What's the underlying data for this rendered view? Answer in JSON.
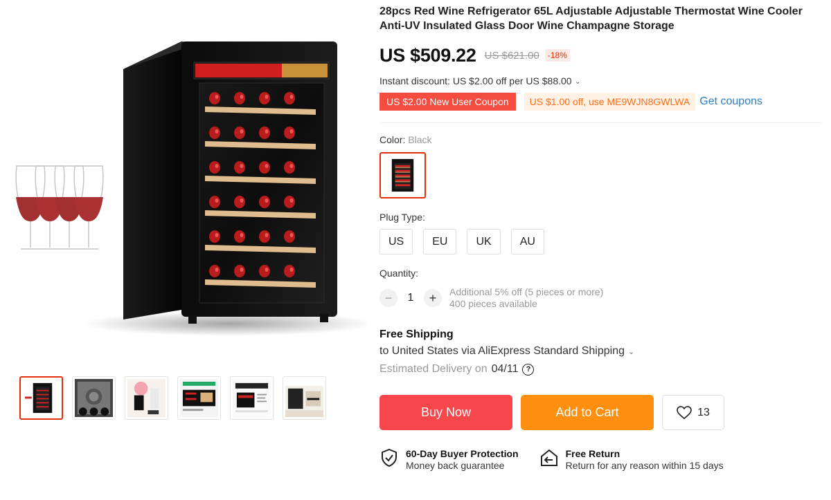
{
  "product": {
    "title": "28pcs Red Wine Refrigerator 65L Adjustable Adjustable Thermostat Wine Cooler Anti-UV Insulated Glass Door Wine Champagne Storage",
    "price": "US $509.22",
    "original_price": "US $621.00",
    "discount": "-18%"
  },
  "promotions": {
    "instant_discount": "Instant discount: US $2.00 off per US $88.00",
    "new_user_coupon": "US $2.00 New User Coupon",
    "code_coupon": "US $1.00 off, use ME9WJN8GWLWA",
    "get_coupons": "Get coupons"
  },
  "options": {
    "color_label": "Color:",
    "color_value": "Black",
    "plug_label": "Plug Type:",
    "plug_types": [
      "US",
      "EU",
      "UK",
      "AU"
    ]
  },
  "quantity": {
    "label": "Quantity:",
    "value": "1",
    "note_discount": "Additional 5% off (5 pieces or more)",
    "note_available": "400 pieces available"
  },
  "shipping": {
    "title": "Free Shipping",
    "destination": "to United States via AliExpress Standard Shipping",
    "estimate_label": "Estimated Delivery on",
    "estimate_date": "04/11"
  },
  "actions": {
    "buy_now": "Buy Now",
    "add_to_cart": "Add to Cart",
    "wishlist_count": "13"
  },
  "guarantees": {
    "protection_title": "60-Day Buyer Protection",
    "protection_sub": "Money back guarantee",
    "return_title": "Free Return",
    "return_sub": "Return for any reason within 15 days"
  },
  "gallery": {
    "thumbnail_count": 6,
    "active_thumbnail": 1
  },
  "colors": {
    "accent_red": "#e62e04",
    "buy_button": "#f7474b",
    "cart_button": "#ff8f0f",
    "link_blue": "#2b7fc2"
  }
}
